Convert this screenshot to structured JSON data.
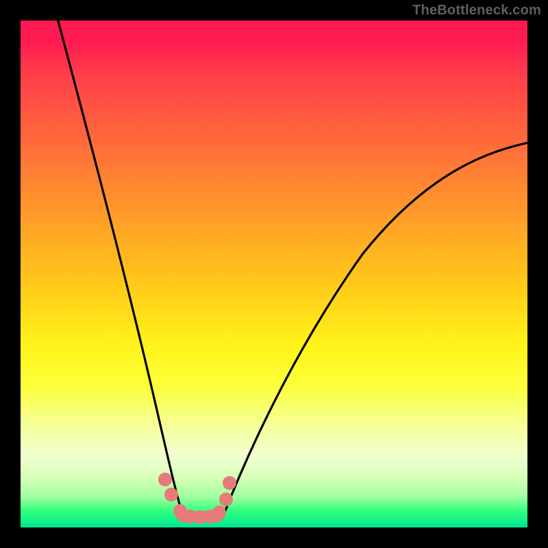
{
  "watermark": "TheBottleneck.com",
  "chart_data": {
    "type": "line",
    "title": "",
    "xlabel": "",
    "ylabel": "",
    "xlim": [
      0,
      100
    ],
    "ylim": [
      0,
      100
    ],
    "grid": false,
    "legend": false,
    "background_gradient": {
      "direction": "vertical",
      "stops": [
        {
          "pos": 0,
          "color": "#ff1a52"
        },
        {
          "pos": 25,
          "color": "#ff6e3a"
        },
        {
          "pos": 50,
          "color": "#ffc91a"
        },
        {
          "pos": 70,
          "color": "#fcff3a"
        },
        {
          "pos": 88,
          "color": "#e8ffc0"
        },
        {
          "pos": 100,
          "color": "#00e592"
        }
      ]
    },
    "series": [
      {
        "name": "left-curve",
        "color": "#000000",
        "x": [
          7,
          10,
          14,
          18,
          22,
          25,
          27,
          29,
          30.5,
          32
        ],
        "y": [
          100,
          82,
          60,
          42,
          27,
          16,
          10,
          6,
          3.5,
          2
        ]
      },
      {
        "name": "right-curve",
        "color": "#000000",
        "x": [
          40,
          43,
          47,
          52,
          58,
          66,
          76,
          88,
          100
        ],
        "y": [
          2,
          5,
          10,
          17,
          26,
          38,
          52,
          65,
          76
        ]
      },
      {
        "name": "bottom-band",
        "type": "scatter",
        "color": "#e77a7a",
        "x": [
          28.5,
          29.8,
          31.5,
          33.5,
          35.5,
          37.5,
          39.2,
          40.5,
          41.2
        ],
        "y": [
          9.5,
          6.5,
          3.2,
          2.2,
          2.0,
          2.2,
          3.0,
          5.5,
          8.8
        ]
      }
    ]
  }
}
